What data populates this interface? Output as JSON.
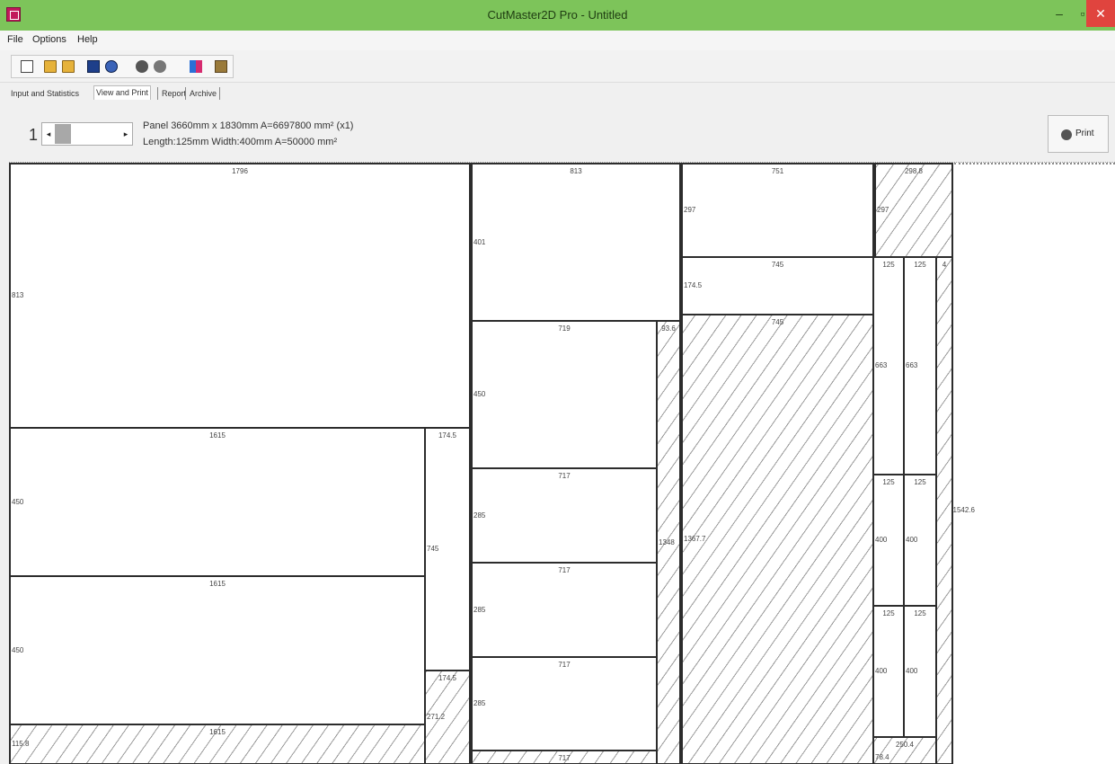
{
  "window": {
    "title": "CutMaster2D Pro - Untitled",
    "minimize_glyph": "–",
    "maximize_glyph": "▫",
    "close_glyph": "✕"
  },
  "menu": {
    "items": [
      "File",
      "Options",
      "Help"
    ]
  },
  "toolbar": {
    "icons": [
      "new-file-icon",
      "open-folder-icon",
      "open-folder-icon",
      "save-icon",
      "save-as-icon",
      "move-up-icon",
      "move-down-icon",
      "colors-icon",
      "report-icon"
    ]
  },
  "tabs": [
    {
      "label": "Input and Statistics",
      "active": false
    },
    {
      "label": "View and Print",
      "active": true
    },
    {
      "label": "Report",
      "active": false
    },
    {
      "label": "Archive",
      "active": false
    }
  ],
  "info": {
    "panel_index": "1",
    "spin_left": "◂",
    "spin_right": "▸",
    "line1": "Panel 3660mm x 1830mm A=6697800 mm² (x1)",
    "line2": "Length:125mm Width:400mm A=50000 mm²",
    "print_label": "Print"
  },
  "pieces": [
    {
      "l": 0,
      "t": 0,
      "w": 514,
      "h": 296,
      "waste": false,
      "top": "1796",
      "left": "813"
    },
    {
      "l": 0,
      "t": 294,
      "w": 464,
      "h": 167,
      "waste": false,
      "top": "1615",
      "left": "450"
    },
    {
      "l": 0,
      "t": 459,
      "w": 464,
      "h": 167,
      "waste": false,
      "top": "1615",
      "left": "450"
    },
    {
      "l": 0,
      "t": 624,
      "w": 464,
      "h": 46,
      "waste": true,
      "top": "1615",
      "left": "115.8"
    },
    {
      "l": 462,
      "t": 294,
      "w": 52,
      "h": 272,
      "waste": false,
      "top": "174.5",
      "left": "745"
    },
    {
      "l": 462,
      "t": 564,
      "w": 52,
      "h": 106,
      "waste": true,
      "top": "174.5",
      "left": "271.2"
    },
    {
      "l": 514,
      "t": 0,
      "w": 234,
      "h": 177,
      "waste": false,
      "top": "813",
      "left": "401"
    },
    {
      "l": 514,
      "t": 175,
      "w": 208,
      "h": 166,
      "waste": false,
      "top": "719",
      "left": "450"
    },
    {
      "l": 514,
      "t": 339,
      "w": 208,
      "h": 107,
      "waste": false,
      "top": "717",
      "left": "285"
    },
    {
      "l": 514,
      "t": 444,
      "w": 208,
      "h": 107,
      "waste": false,
      "top": "717",
      "left": "285"
    },
    {
      "l": 514,
      "t": 549,
      "w": 208,
      "h": 106,
      "waste": false,
      "top": "717",
      "left": "285"
    },
    {
      "l": 514,
      "t": 653,
      "w": 208,
      "h": 17,
      "waste": true,
      "top": "717",
      "left": ""
    },
    {
      "l": 720,
      "t": 175,
      "w": 28,
      "h": 495,
      "waste": true,
      "top": "93.6",
      "left": "1348"
    },
    {
      "l": 748,
      "t": 0,
      "w": 215,
      "h": 106,
      "waste": false,
      "top": "751",
      "left": "297"
    },
    {
      "l": 748,
      "t": 104,
      "w": 215,
      "h": 66,
      "waste": false,
      "top": "745",
      "left": "174.5"
    },
    {
      "l": 748,
      "t": 168,
      "w": 215,
      "h": 502,
      "waste": true,
      "top": "745",
      "left": "1367.7"
    },
    {
      "l": 963,
      "t": 0,
      "w": 88,
      "h": 106,
      "waste": true,
      "top": "298.8",
      "left": "297"
    },
    {
      "l": 961,
      "t": 104,
      "w": 36,
      "h": 244,
      "waste": false,
      "top": "125",
      "left": "663"
    },
    {
      "l": 995,
      "t": 104,
      "w": 38,
      "h": 244,
      "waste": false,
      "top": "125",
      "left": "663"
    },
    {
      "l": 961,
      "t": 346,
      "w": 36,
      "h": 148,
      "waste": false,
      "top": "125",
      "left": "400"
    },
    {
      "l": 995,
      "t": 346,
      "w": 38,
      "h": 148,
      "waste": false,
      "top": "125",
      "left": "400"
    },
    {
      "l": 961,
      "t": 492,
      "w": 36,
      "h": 148,
      "waste": false,
      "top": "125",
      "left": "400"
    },
    {
      "l": 995,
      "t": 492,
      "w": 38,
      "h": 148,
      "waste": false,
      "top": "125",
      "left": "400"
    },
    {
      "l": 961,
      "t": 638,
      "w": 72,
      "h": 32,
      "waste": true,
      "top": "250.4",
      "left": "78.4"
    },
    {
      "l": 1031,
      "t": 104,
      "w": 20,
      "h": 566,
      "waste": true,
      "top": "4",
      "left": "",
      "right": "1542.6"
    }
  ]
}
